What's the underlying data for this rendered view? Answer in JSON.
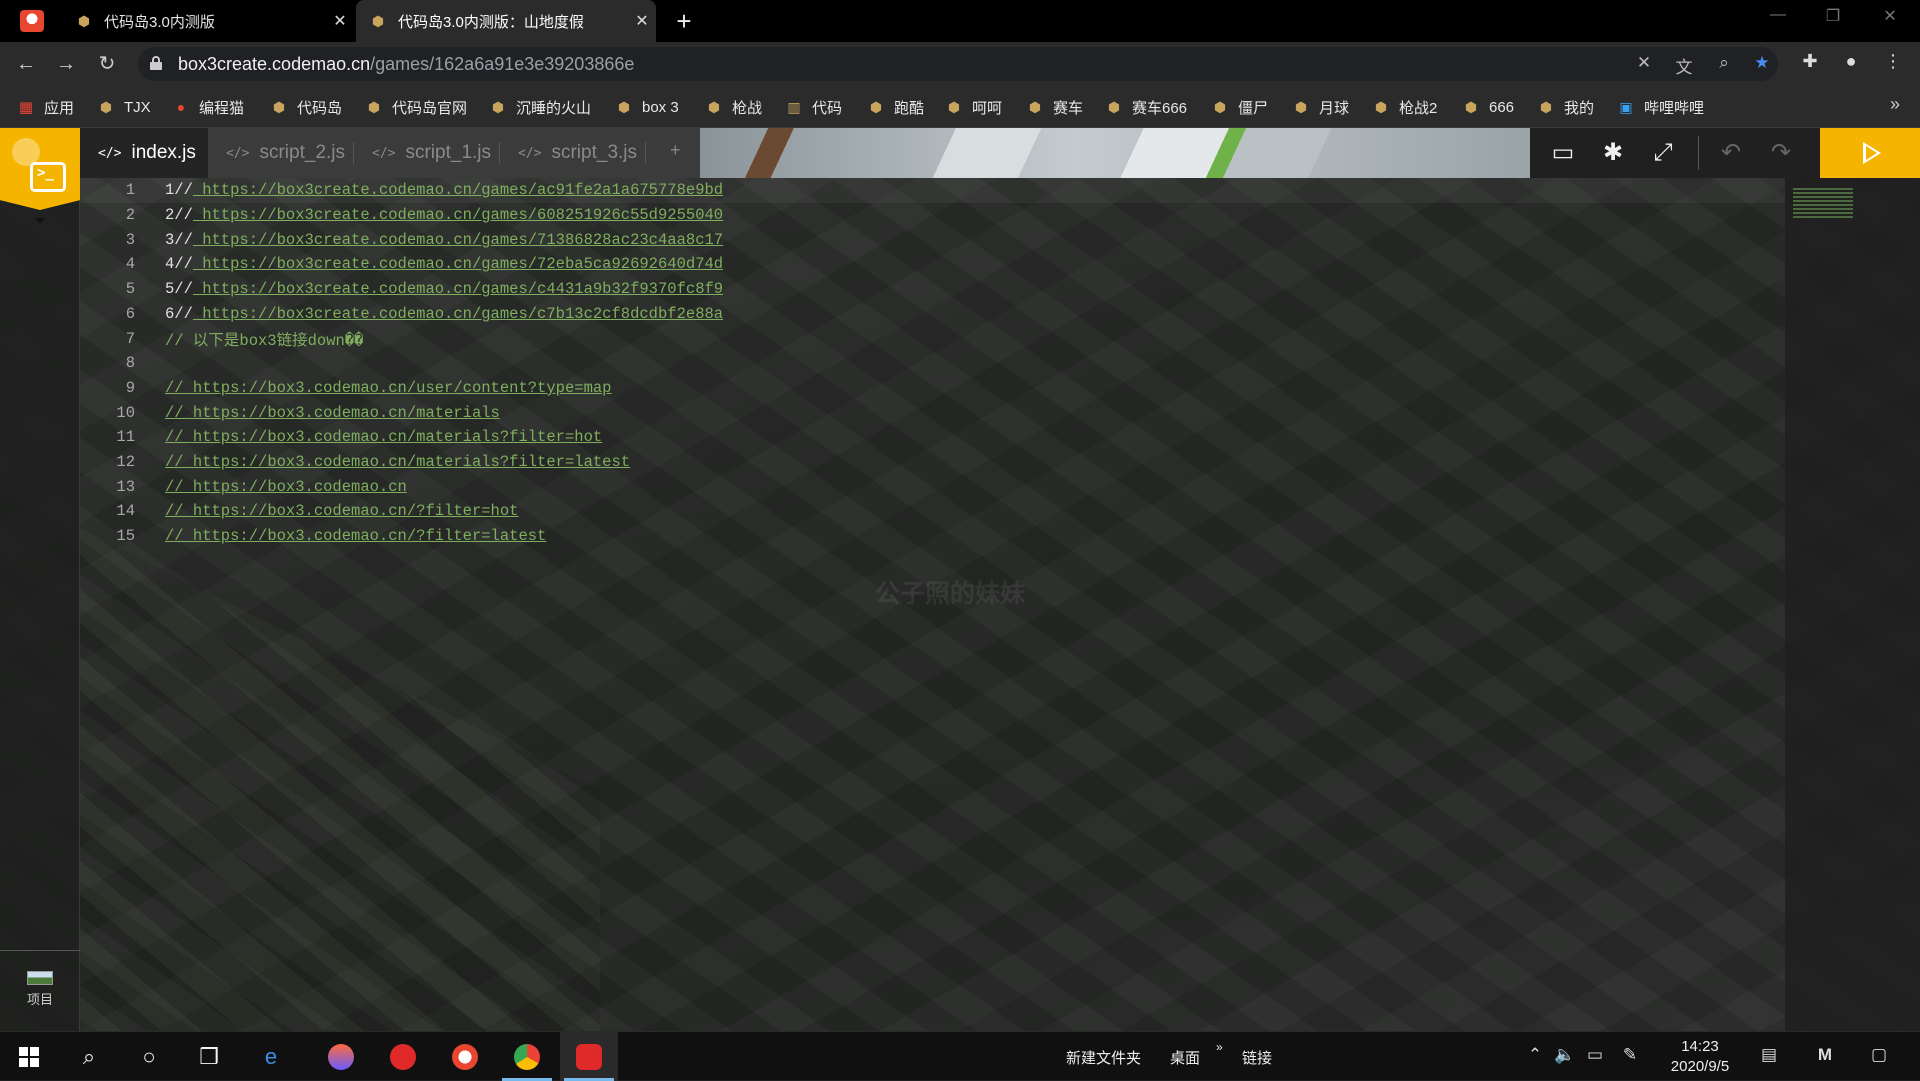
{
  "browser": {
    "tabs": [
      {
        "title": "代码岛3.0内测版",
        "active": false
      },
      {
        "title": "代码岛3.0内测版：山地度假",
        "active": true
      }
    ],
    "address": {
      "host": "box3create.codemao.cn",
      "path": "/games/162a6a91e3e39203866e"
    },
    "bookmarks": [
      {
        "label": "应用",
        "icon": "apps-grid-icon"
      },
      {
        "label": "TJX",
        "icon": "codemao-icon"
      },
      {
        "label": "编程猫",
        "icon": "bcm-logo-icon"
      },
      {
        "label": "代码岛",
        "icon": "codemao-icon"
      },
      {
        "label": "代码岛官网",
        "icon": "codemao-icon"
      },
      {
        "label": "沉睡的火山",
        "icon": "codemao-icon"
      },
      {
        "label": "box 3",
        "icon": "codemao-icon"
      },
      {
        "label": "枪战",
        "icon": "codemao-icon"
      },
      {
        "label": "代码",
        "icon": "book-icon"
      },
      {
        "label": "跑酷",
        "icon": "codemao-icon"
      },
      {
        "label": "呵呵",
        "icon": "codemao-icon"
      },
      {
        "label": "赛车",
        "icon": "codemao-icon"
      },
      {
        "label": "赛车666",
        "icon": "codemao-icon"
      },
      {
        "label": "僵尸",
        "icon": "codemao-icon"
      },
      {
        "label": "月球",
        "icon": "codemao-icon"
      },
      {
        "label": "枪战2",
        "icon": "codemao-icon"
      },
      {
        "label": "666",
        "icon": "codemao-icon"
      },
      {
        "label": "我的",
        "icon": "codemao-icon"
      },
      {
        "label": "哔哩哔哩",
        "icon": "bilibili-icon"
      }
    ],
    "bookmarks_more": "»"
  },
  "ide": {
    "file_tabs": [
      {
        "label": "index.js",
        "active": true
      },
      {
        "label": "script_2.js",
        "active": false
      },
      {
        "label": "script_1.js",
        "active": false
      },
      {
        "label": "script_3.js",
        "active": false
      }
    ],
    "add_file": "+",
    "project_label": "项目",
    "watermark": "公子照的妹妹",
    "code_lines": [
      {
        "n": "1",
        "lead": "1//",
        "text": " https://box3create.codemao.cn/games/ac91fe2a1a675778e9bd",
        "link": true
      },
      {
        "n": "2",
        "lead": "2//",
        "text": " https://box3create.codemao.cn/games/608251926c55d9255040",
        "link": true
      },
      {
        "n": "3",
        "lead": "3//",
        "text": " https://box3create.codemao.cn/games/71386828ac23c4aa8c17",
        "link": true
      },
      {
        "n": "4",
        "lead": "4//",
        "text": " https://box3create.codemao.cn/games/72eba5ca92692640d74d",
        "link": true
      },
      {
        "n": "5",
        "lead": "5//",
        "text": " https://box3create.codemao.cn/games/c4431a9b32f9370fc8f9",
        "link": true
      },
      {
        "n": "6",
        "lead": "6//",
        "text": " https://box3create.codemao.cn/games/c7b13c2cf8dcdbf2e88a",
        "link": true
      },
      {
        "n": "7",
        "lead": "",
        "text": "// 以下是box3链接down��",
        "link": false
      },
      {
        "n": "8",
        "lead": "",
        "text": "",
        "link": false
      },
      {
        "n": "9",
        "lead": "",
        "text": "// https://box3.codemao.cn/user/content?type=map",
        "link": true
      },
      {
        "n": "10",
        "lead": "",
        "text": "// https://box3.codemao.cn/materials",
        "link": true
      },
      {
        "n": "11",
        "lead": "",
        "text": "// https://box3.codemao.cn/materials?filter=hot",
        "link": true
      },
      {
        "n": "12",
        "lead": "",
        "text": "// https://box3.codemao.cn/materials?filter=latest",
        "link": true
      },
      {
        "n": "13",
        "lead": "",
        "text": "// https://box3.codemao.cn",
        "link": true
      },
      {
        "n": "14",
        "lead": "",
        "text": "// https://box3.codemao.cn/?filter=hot",
        "link": true
      },
      {
        "n": "15",
        "lead": "",
        "text": "// https://box3.codemao.cn/?filter=latest",
        "link": true
      }
    ]
  },
  "taskbar": {
    "labels": [
      "新建文件夹",
      "桌面",
      "链接"
    ],
    "chevron": "»",
    "time": "14:23",
    "date": "2020/9/5"
  },
  "colors": {
    "accent": "#f5b400",
    "code_green": "#7fae5e"
  }
}
